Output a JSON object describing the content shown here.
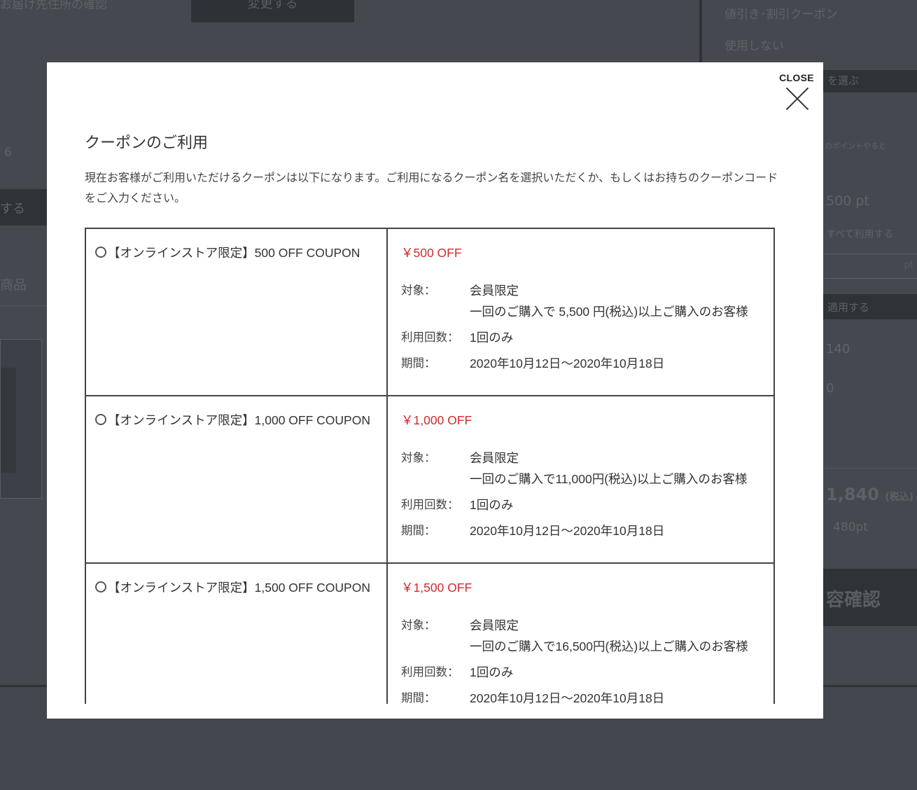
{
  "background": {
    "top_button": "変更する",
    "top_left_text": "お届け先住所の確認",
    "discount_coupon_label": "値引き･割引クーポン",
    "coupon_unused": "使用しない",
    "select_bar": "を選ぶ",
    "left_number": "6",
    "points_note": "のポイントやると",
    "points_value": "500 pt",
    "left_bar": "する",
    "use_all_points": "すべて利用する",
    "points_unit": "pt",
    "left_heading": "商品",
    "apply_bar": "適用する",
    "value_a": "140",
    "value_b": "0",
    "total": "1,840",
    "total_tax": "(税込)",
    "earned_points": "480pt",
    "confirm_button": "容確認"
  },
  "modal": {
    "close_label": "CLOSE",
    "title": "クーポンのご利用",
    "description": "現在お客様がご利用いただけるクーポンは以下になります。ご利用になるクーポン名を選択いただくか、もしくはお持ちのクーポンコードをご入力ください。",
    "labels": {
      "target": "対象：",
      "usage": "利用回数：",
      "period": "期間："
    },
    "coupons": [
      {
        "name": "【オンラインストア限定】500 OFF COUPON",
        "price": "￥500 OFF",
        "target_line1": "会員限定",
        "target_line2": "一回のご購入で 5,500 円(税込)以上ご購入のお客様",
        "usage": "1回のみ",
        "period": "2020年10月12日〜2020年10月18日"
      },
      {
        "name": "【オンラインストア限定】1,000 OFF COUPON",
        "price": "￥1,000 OFF",
        "target_line1": "会員限定",
        "target_line2": "一回のご購入で11,000円(税込)以上ご購入のお客様",
        "usage": "1回のみ",
        "period": "2020年10月12日〜2020年10月18日"
      },
      {
        "name": "【オンラインストア限定】1,500 OFF COUPON",
        "price": "￥1,500 OFF",
        "target_line1": "会員限定",
        "target_line2": "一回のご購入で16,500円(税込)以上ご購入のお客様",
        "usage": "1回のみ",
        "period": "2020年10月12日〜2020年10月18日"
      }
    ]
  }
}
